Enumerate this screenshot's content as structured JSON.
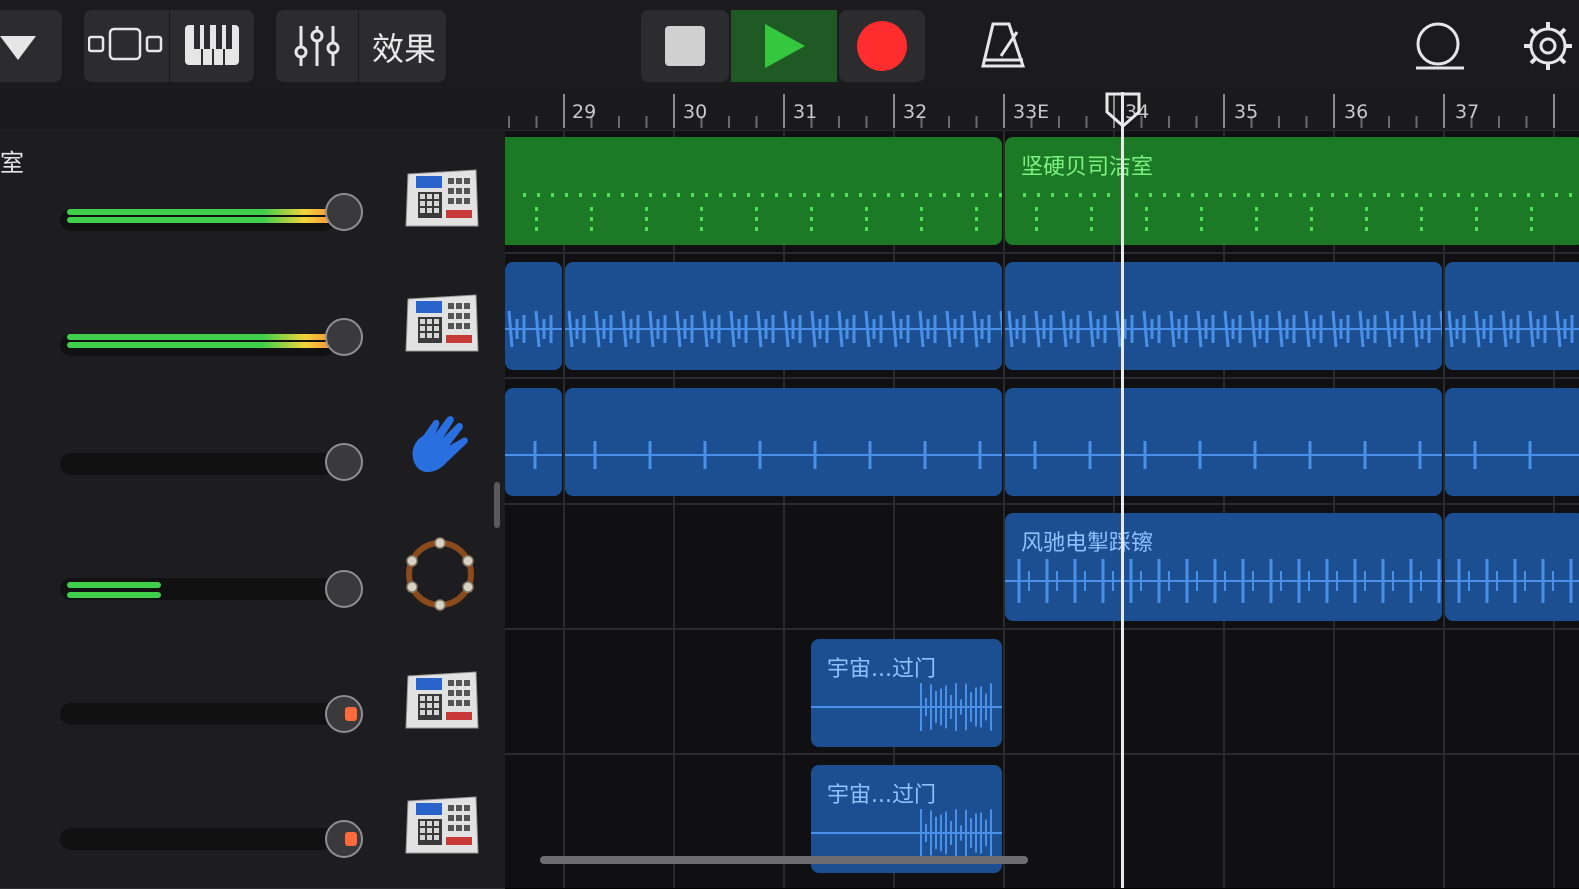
{
  "toolbar": {
    "effects_label": "效果",
    "colors": {
      "play_bg": "#1f5a25",
      "play_icon": "#35c83f",
      "record": "#ff2d2d",
      "stop": "#d0d0d0"
    }
  },
  "ruler": {
    "labels": [
      "29",
      "30",
      "31",
      "32",
      "33E",
      "34",
      "35",
      "36",
      "37"
    ]
  },
  "tracks": [
    {
      "name_fragment": "室",
      "volume_fill": "full-green-yellow",
      "instrument": "drum-machine-icon"
    },
    {
      "volume_fill": "full-green-yellow",
      "instrument": "drum-machine-icon"
    },
    {
      "volume_fill": "none",
      "instrument": "hand-clap-icon"
    },
    {
      "volume_fill": "partial-green",
      "instrument": "tambourine-icon"
    },
    {
      "volume_fill": "none",
      "instrument": "drum-machine-icon"
    },
    {
      "volume_fill": "none",
      "instrument": "drum-machine-icon"
    }
  ],
  "regions": {
    "green_label": "坚硬贝司洁室",
    "cymbal_label": "风驰电掣踩镲",
    "fill1_label": "宇宙...过门",
    "fill2_label": "宇宙...过门",
    "colors": {
      "green": "#1c7a26",
      "blue": "#1b4f91",
      "blue_wave": "#4a90e8"
    }
  }
}
